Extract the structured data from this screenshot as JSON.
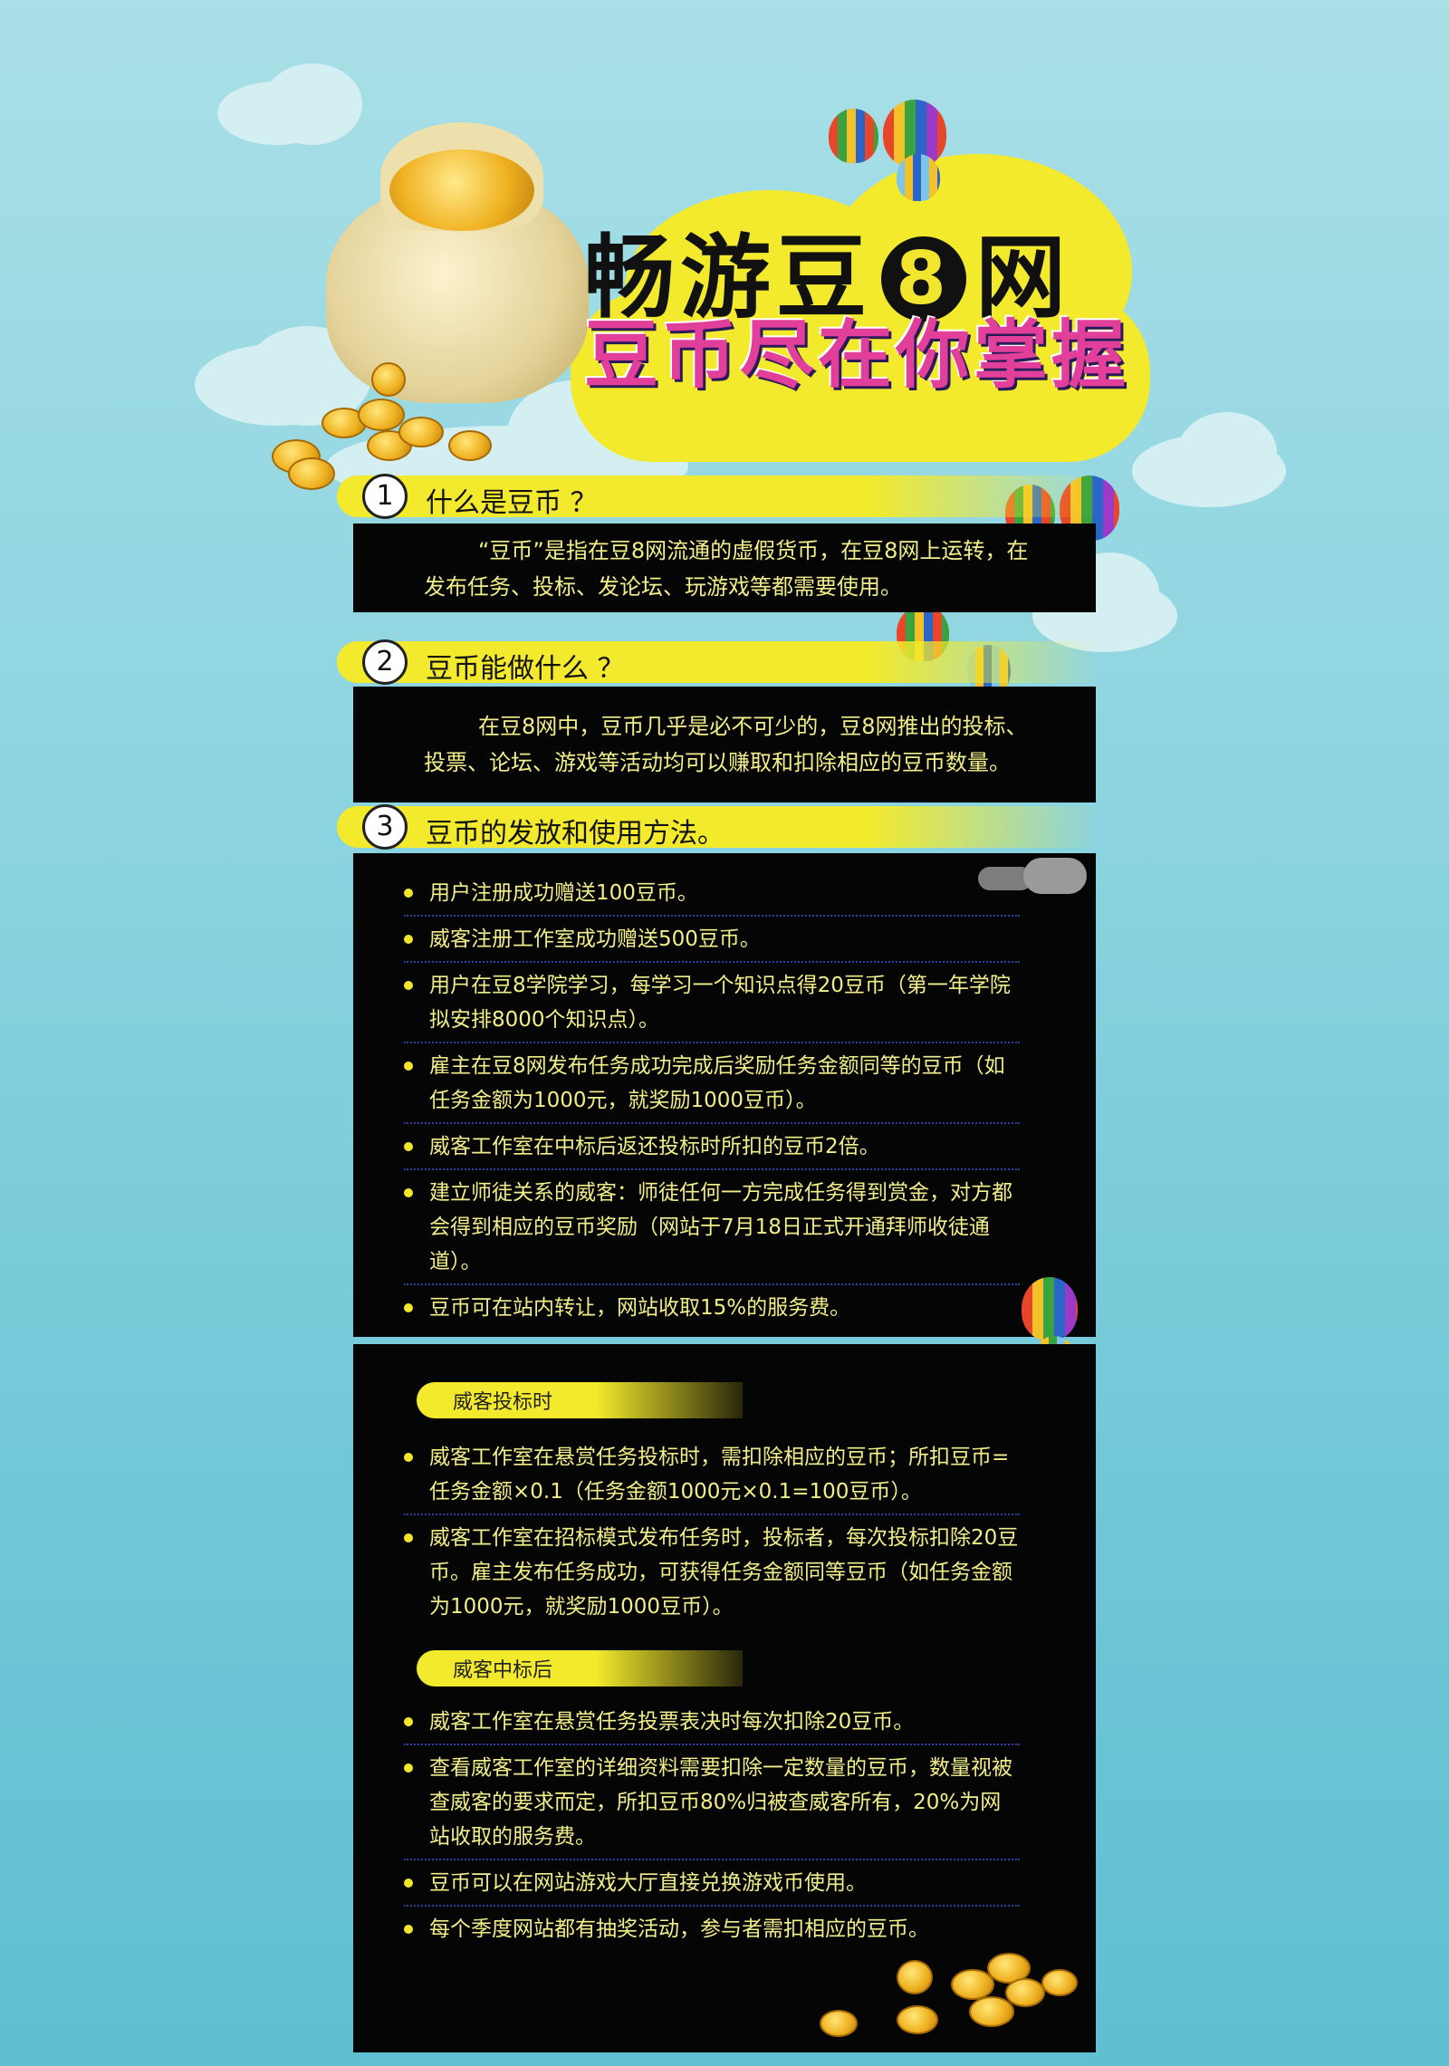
{
  "header": {
    "title_prefix": "畅游豆",
    "title_eight": "8",
    "title_suffix": "网",
    "subtitle": "豆币尽在你掌握"
  },
  "sections": [
    {
      "num": "1",
      "title": "什么是豆币 ？",
      "text": "“豆币”是指在豆8网流通的虚假货币，在豆8网上运转，在发布任务、投标、发论坛、玩游戏等都需要使用。"
    },
    {
      "num": "2",
      "title": "豆币能做什么 ？",
      "text": "在豆8网中，豆币几乎是必不可少的，豆8网推出的投标、投票、论坛、游戏等活动均可以赚取和扣除相应的豆币数量。"
    },
    {
      "num": "3",
      "title": "豆币的发放和使用方法。",
      "items": [
        "用户注册成功赠送100豆币。",
        "威客注册工作室成功赠送500豆币。",
        "用户在豆8学院学习，每学习一个知识点得20豆币（第一年学院拟安排8000个知识点）。",
        "雇主在豆8网发布任务成功完成后奖励任务金额同等的豆币（如任务金额为1000元，就奖励1000豆币）。",
        "威客工作室在中标后返还投标时所扣的豆币2倍。",
        "建立师徒关系的威客：师徒任何一方完成任务得到赏金，对方都会得到相应的豆币奖励（网站于7月18日正式开通拜师收徒通道）。",
        "豆币可在站内转让，网站收取15%的服务费。"
      ]
    }
  ],
  "bidding": {
    "tag": "威客投标时",
    "items": [
      "威客工作室在悬赏任务投标时，需扣除相应的豆币；所扣豆币=任务金额×0.1（任务金额1000元×0.1=100豆币）。",
      "威客工作室在招标模式发布任务时，投标者，每次投标扣除20豆币。雇主发布任务成功，可获得任务金额同等豆币（如任务金额为1000元，就奖励1000豆币）。"
    ]
  },
  "after_win": {
    "tag": "威客中标后",
    "items": [
      "威客工作室在悬赏任务投票表决时每次扣除20豆币。",
      "查看威客工作室的详细资料需要扣除一定数量的豆币，数量视被查威客的要求而定，所扣豆币80%归被查威客所有，20%为网站收取的服务费。",
      "豆币可以在网站游戏大厅直接兑换游戏币使用。",
      "每个季度网站都有抽奖活动，参与者需扣相应的豆币。"
    ]
  },
  "colors": {
    "accent_yellow": "#f3ea2d",
    "panel_black": "#050505",
    "text_yellow": "#f2ee8a",
    "sky_top": "#a9dfe6",
    "sky_bottom": "#5fc0d2"
  },
  "icons": [
    "money-bag-icon",
    "coin-icon",
    "hot-air-balloon-icon",
    "cloud-icon"
  ]
}
